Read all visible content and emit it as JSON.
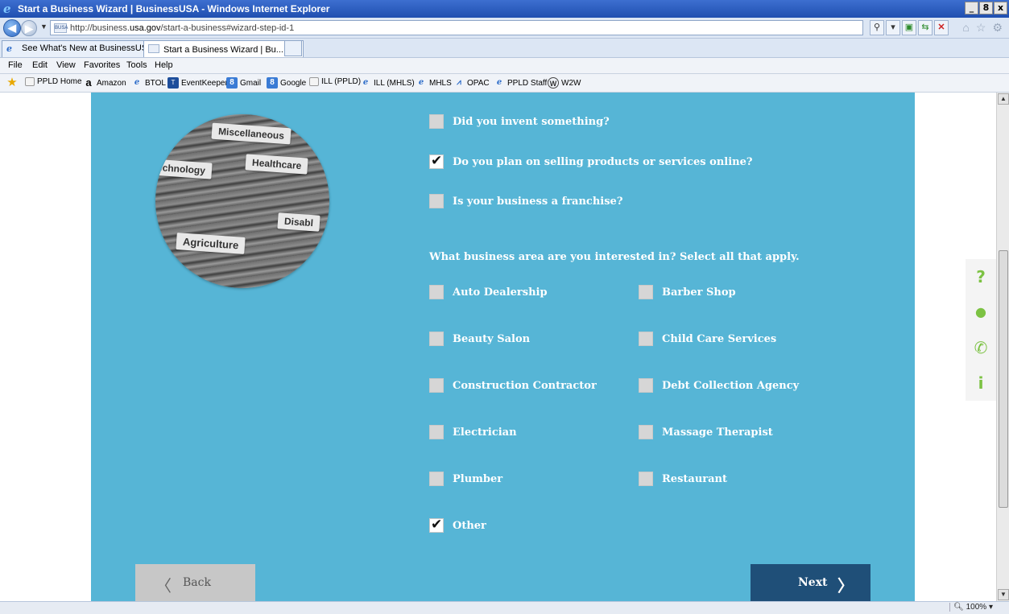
{
  "window": {
    "title": "Start a Business Wizard | BusinessUSA - Windows Internet Explorer",
    "controls": [
      "_",
      "8",
      "x"
    ]
  },
  "address_bar": {
    "url_prefix": "http://business.",
    "url_domain": "usa.gov",
    "url_suffix": "/start-a-business#wizard-step-id-1",
    "favicon_text": "BUSA"
  },
  "tabs": [
    {
      "label": "See What's New at BusinessUS...",
      "active": false
    },
    {
      "label": "Start a Business Wizard | Bu...",
      "active": true,
      "close": "✕"
    }
  ],
  "menu": [
    "File",
    "Edit",
    "View",
    "Favorites",
    "Tools",
    "Help"
  ],
  "favorites": [
    "PPLD Home",
    "Amazon",
    "BTOL",
    "EventKeeper",
    "Gmail",
    "Google",
    "ILL (PPLD)",
    "ILL (MHLS)",
    "MHLS",
    "OPAC",
    "PPLD Staff",
    "W2W"
  ],
  "hero": {
    "folder_tabs": [
      "Miscellaneous",
      "echnology",
      "Healthcare",
      "Disabl",
      "Agriculture"
    ]
  },
  "yes_no_questions": [
    {
      "label": "Did you invent something?",
      "checked": false
    },
    {
      "label": "Do you plan on selling products or services online?",
      "checked": true
    },
    {
      "label": "Is your business a franchise?",
      "checked": false
    }
  ],
  "business_area_question": "What business area are you interested in? Select all that apply.",
  "business_areas": [
    {
      "label": "Auto Dealership",
      "checked": false
    },
    {
      "label": "Barber Shop",
      "checked": false
    },
    {
      "label": "Beauty Salon",
      "checked": false
    },
    {
      "label": "Child Care Services",
      "checked": false
    },
    {
      "label": "Construction Contractor",
      "checked": false
    },
    {
      "label": "Debt Collection Agency",
      "checked": false
    },
    {
      "label": "Electrician",
      "checked": false
    },
    {
      "label": "Massage Therapist",
      "checked": false
    },
    {
      "label": "Plumber",
      "checked": false
    },
    {
      "label": "Restaurant",
      "checked": false
    },
    {
      "label": "Other",
      "checked": true
    }
  ],
  "nav": {
    "back_label": "Back",
    "next_label": "Next",
    "back_chevron": "〈",
    "next_chevron": "〉"
  },
  "side_tools": [
    {
      "icon": "question-icon",
      "glyph": "?"
    },
    {
      "icon": "lightbulb-icon",
      "glyph": "●"
    },
    {
      "icon": "phone-icon",
      "glyph": "✆"
    },
    {
      "icon": "info-icon",
      "glyph": "i"
    }
  ],
  "status": {
    "zoom": "100%"
  },
  "colors": {
    "panel": "#56b5d6",
    "next_button": "#1f4f78",
    "back_button": "#c7c7c7",
    "side_tool_icon": "#7cc243"
  }
}
